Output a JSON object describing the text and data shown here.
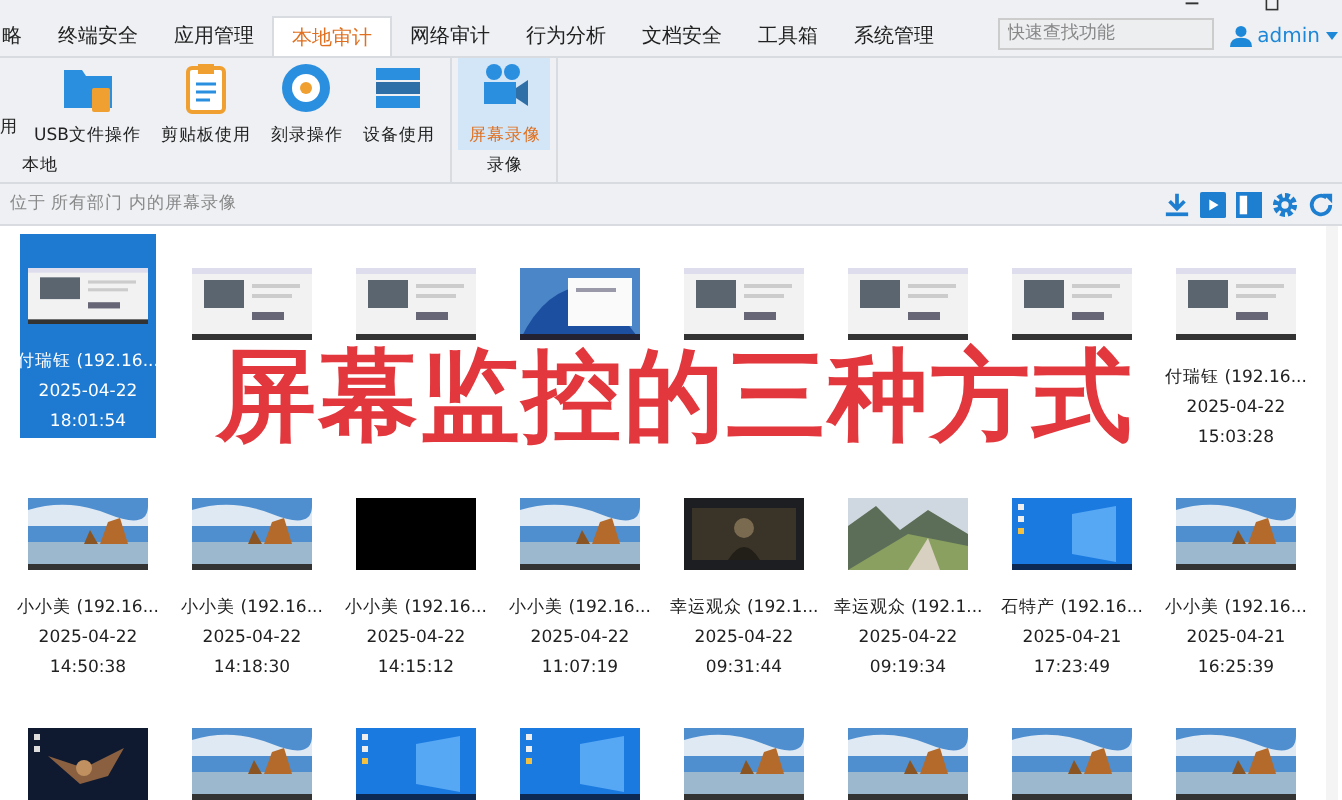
{
  "tabs": [
    {
      "label": "略",
      "selected": false
    },
    {
      "label": "终端安全",
      "selected": false
    },
    {
      "label": "应用管理",
      "selected": false
    },
    {
      "label": "本地审计",
      "selected": true
    },
    {
      "label": "网络审计",
      "selected": false
    },
    {
      "label": "行为分析",
      "selected": false
    },
    {
      "label": "文档安全",
      "selected": false
    },
    {
      "label": "工具箱",
      "selected": false
    },
    {
      "label": "系统管理",
      "selected": false
    }
  ],
  "search": {
    "placeholder": "快速查找功能"
  },
  "user": {
    "name": "admin"
  },
  "ribbon_groups": [
    {
      "label": "本地",
      "items": [
        {
          "label": "用",
          "kind": "cut",
          "selected": false
        },
        {
          "label": "USB文件操作",
          "kind": "usb",
          "selected": false
        },
        {
          "label": "剪贴板使用",
          "kind": "clipboard",
          "selected": false
        },
        {
          "label": "刻录操作",
          "kind": "disc",
          "selected": false
        },
        {
          "label": "设备使用",
          "kind": "device",
          "selected": false
        }
      ]
    },
    {
      "label": "录像",
      "items": [
        {
          "label": "屏幕录像",
          "kind": "camera",
          "selected": true
        }
      ]
    }
  ],
  "breadcrumb": "位于 所有部门 内的屏幕录像",
  "banner": "屏幕监控的三种方式",
  "recordings": [
    {
      "kind": "picture",
      "selected": true,
      "name": "付瑞钰 (192.16...",
      "date": "2025-04-22",
      "time": "18:01:54"
    },
    {
      "kind": "picture",
      "selected": false
    },
    {
      "kind": "picture",
      "selected": false
    },
    {
      "kind": "picture",
      "selected": false
    },
    {
      "kind": "picture",
      "selected": false
    },
    {
      "kind": "picture",
      "selected": false
    },
    {
      "kind": "picture",
      "selected": false
    },
    {
      "kind": "picture",
      "selected": false,
      "name": "付瑞钰 (192.16...",
      "date": "2025-04-22",
      "time": "15:03:28"
    },
    {
      "kind": "picture",
      "selected": false,
      "name": "小小美 (192.16...",
      "date": "2025-04-22",
      "time": "14:50:38"
    },
    {
      "kind": "picture",
      "selected": false,
      "name": "小小美 (192.16...",
      "date": "2025-04-22",
      "time": "14:18:30"
    },
    {
      "kind": "picture",
      "selected": false,
      "name": "小小美 (192.16...",
      "date": "2025-04-22",
      "time": "14:15:12"
    },
    {
      "kind": "picture",
      "selected": false,
      "name": "小小美 (192.16...",
      "date": "2025-04-22",
      "time": "11:07:19"
    },
    {
      "kind": "picture",
      "selected": false,
      "name": "幸运观众 (192.1...",
      "date": "2025-04-22",
      "time": "09:31:44"
    },
    {
      "kind": "picture",
      "selected": false,
      "name": "幸运观众 (192.1...",
      "date": "2025-04-22",
      "time": "09:19:34"
    },
    {
      "kind": "picture",
      "selected": false,
      "name": "石特产 (192.16...",
      "date": "2025-04-21",
      "time": "17:23:49"
    },
    {
      "kind": "picture",
      "selected": false,
      "name": "小小美 (192.16...",
      "date": "2025-04-21",
      "time": "16:25:39"
    },
    {
      "kind": "picture",
      "selected": false
    },
    {
      "kind": "picture",
      "selected": false
    },
    {
      "kind": "picture",
      "selected": false
    },
    {
      "kind": "picture",
      "selected": false
    },
    {
      "kind": "picture",
      "selected": false
    },
    {
      "kind": "picture",
      "selected": false
    },
    {
      "kind": "picture",
      "selected": false
    },
    {
      "kind": "picture",
      "selected": false
    }
  ]
}
